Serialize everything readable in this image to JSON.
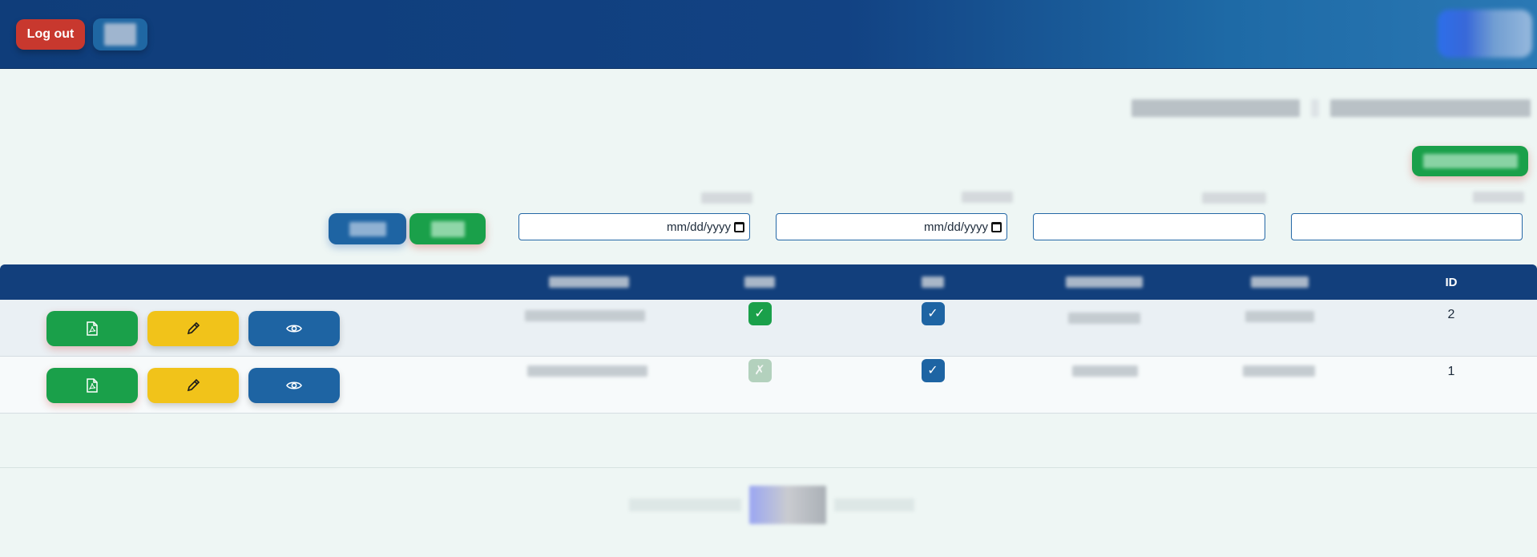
{
  "header": {
    "logout_label": "Log out",
    "lang_label": "",
    "logo": "brand-logo"
  },
  "page": {
    "title": ""
  },
  "toolbar": {
    "add_label": ""
  },
  "filters": {
    "search_label": "",
    "reset_label": "",
    "date_from_placeholder": "mm/dd/yyyy",
    "date_to_placeholder": "mm/dd/yyyy",
    "date_from_value": "",
    "date_to_value": "",
    "text1_value": "",
    "text2_value": ""
  },
  "table": {
    "columns": [
      "",
      "",
      "",
      "",
      "",
      "ID"
    ],
    "rows": [
      {
        "id": "2",
        "col_a": "",
        "check1": "✓",
        "check1_state": "on",
        "check2": "✓",
        "check2_state": "on",
        "col_d": "",
        "col_e": ""
      },
      {
        "id": "1",
        "col_a": "",
        "check1": "✗",
        "check1_state": "off",
        "check2": "✓",
        "check2_state": "on",
        "col_d": "",
        "col_e": ""
      }
    ],
    "actions": [
      "pdf-icon",
      "pencil-icon",
      "eye-icon"
    ]
  },
  "footer": {
    "text": ""
  },
  "colors": {
    "header": "#123f7c",
    "danger": "#c8382e",
    "success": "#1aa04a",
    "warning": "#f1c31a",
    "primary": "#1e64a3"
  }
}
